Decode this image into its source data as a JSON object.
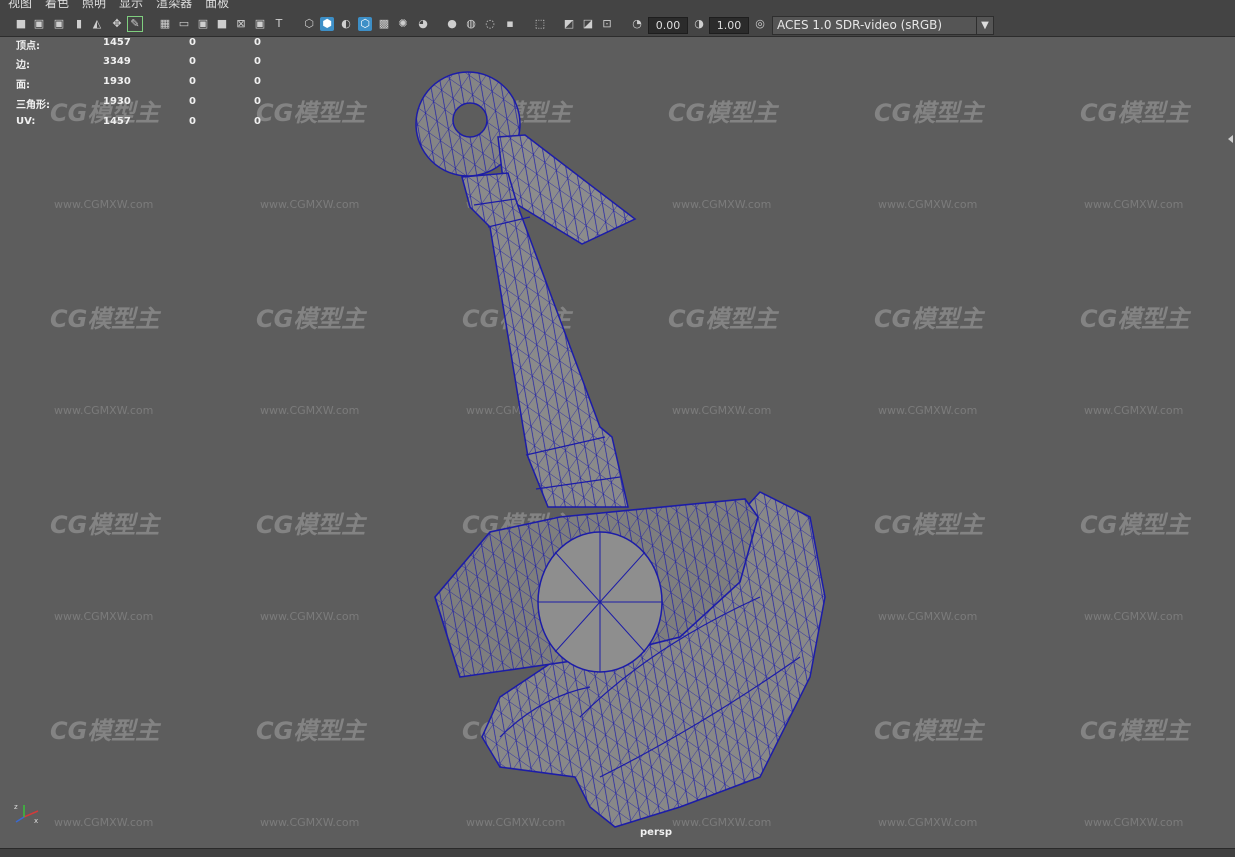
{
  "menu": [
    "视图",
    "着色",
    "照明",
    "显示",
    "渲染器",
    "面板"
  ],
  "toolbar": {
    "exposure_value": "0.00",
    "gamma_value": "1.00",
    "colorspace": "ACES 1.0 SDR-video (sRGB)",
    "icons": [
      "camera-select-icon",
      "camera-attr-icon",
      "bookmark-icon",
      "image-plane-icon",
      "2d-pan-icon",
      "grease-pencil-icon",
      "grid-icon",
      "film-gate-icon",
      "resolution-gate-icon",
      "gate-mask-icon",
      "field-chart-icon",
      "safe-action-icon",
      "safe-title-icon",
      "wireframe-icon",
      "smooth-shade-icon",
      "default-material-icon",
      "wireframe-on-shaded-icon",
      "xray-icon",
      "lighting-icon",
      "shadows-icon",
      "ambient-occlusion-icon",
      "motion-blur-icon",
      "antialias-icon",
      "depth-of-field-icon",
      "isolate-select-icon",
      "xray-joints-icon",
      "xray-components-icon",
      "hud-icon",
      "exposure-icon",
      "gamma-icon",
      "color-management-icon"
    ]
  },
  "hud": {
    "rows": [
      {
        "label": "顶点:",
        "v1": "1457",
        "v2": "0",
        "v3": "0"
      },
      {
        "label": "边:",
        "v1": "3349",
        "v2": "0",
        "v3": "0"
      },
      {
        "label": "面:",
        "v1": "1930",
        "v2": "0",
        "v3": "0"
      },
      {
        "label": "三角形:",
        "v1": "1930",
        "v2": "0",
        "v3": "0"
      },
      {
        "label": "UV:",
        "v1": "1457",
        "v2": "0",
        "v3": "0"
      }
    ]
  },
  "watermark": {
    "logo": "CG模型主",
    "url": "www.CGMXW.com"
  },
  "camera_label": "persp",
  "axes": {
    "x": "x",
    "y": "y",
    "z": "z"
  },
  "colors": {
    "viewport_bg": "#5d5d5d",
    "wireframe": "#1c1ca8",
    "mesh_fill": "#8a8a8a",
    "toolbar_bg": "#444444",
    "selected_icon": "#3d8fc7"
  }
}
